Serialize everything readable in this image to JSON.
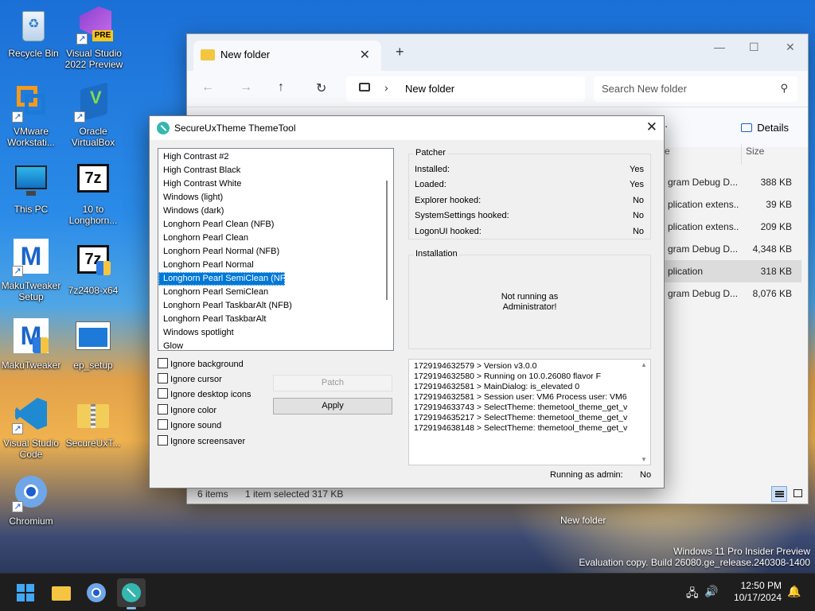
{
  "desktop": {
    "icons": [
      {
        "label": "Recycle Bin",
        "icon": "recycle-bin-icon"
      },
      {
        "label": "Visual Studio 2022 Preview",
        "badge": "PRE",
        "icon": "visual-studio-preview-icon"
      },
      {
        "label": "VMware Workstati...",
        "icon": "vmware-icon"
      },
      {
        "label": "Oracle VirtualBox",
        "icon": "virtualbox-icon"
      },
      {
        "label": "This PC",
        "icon": "monitor-icon"
      },
      {
        "label": "10 to Longhorn...",
        "icon": "7zip-icon"
      },
      {
        "label": "MakuTweaker Setup",
        "icon": "makutweaker-icon"
      },
      {
        "label": "7z2408-x64",
        "icon": "7zip-installer-icon"
      },
      {
        "label": "MakuTweaker",
        "icon": "makutweaker-icon"
      },
      {
        "label": "ep_setup",
        "icon": "setup-icon"
      },
      {
        "label": "Visual Studio Code",
        "icon": "vscode-icon"
      },
      {
        "label": "SecureUxT...",
        "icon": "zip-folder-icon"
      },
      {
        "label": "Chromium",
        "icon": "chromium-icon"
      },
      {
        "label": "New folder"
      }
    ],
    "watermark_line1": "Windows 11 Pro Insider Preview",
    "watermark_line2": "Evaluation copy. Build 26080.ge_release.240308-1400"
  },
  "explorer": {
    "tab_title": "New folder",
    "address": "New folder",
    "search_placeholder": "Search New folder",
    "details_label": "Details",
    "col_name_partial": "e",
    "col_size": "Size",
    "files": [
      {
        "name": "gram Debug D...",
        "size": "388 KB",
        "selected": false
      },
      {
        "name": "plication extens...",
        "size": "39 KB",
        "selected": false
      },
      {
        "name": "plication extens...",
        "size": "209 KB",
        "selected": false
      },
      {
        "name": "gram Debug D...",
        "size": "4,348 KB",
        "selected": false
      },
      {
        "name": "plication",
        "size": "318 KB",
        "selected": true
      },
      {
        "name": "gram Debug D...",
        "size": "8,076 KB",
        "selected": false
      }
    ],
    "status_items": "6 items",
    "status_selected": "1 item selected  317 KB"
  },
  "dialog": {
    "title": "SecureUxTheme ThemeTool",
    "themes": [
      "High Contrast #2",
      "High Contrast Black",
      "High Contrast White",
      "Windows (light)",
      "Windows (dark)",
      "Longhorn Pearl Clean (NFB)",
      "Longhorn Pearl Clean",
      "Longhorn Pearl Normal (NFB)",
      "Longhorn Pearl Normal",
      "Longhorn Pearl SemiClean (NFB)",
      "Longhorn Pearl SemiClean",
      "Longhorn Pearl TaskbarAlt (NFB)",
      "Longhorn Pearl TaskbarAlt",
      "Windows spotlight",
      "Glow"
    ],
    "selected_theme_index": 9,
    "options": [
      "Ignore background",
      "Ignore cursor",
      "Ignore desktop icons",
      "Ignore color",
      "Ignore sound",
      "Ignore screensaver"
    ],
    "patch_label": "Patch",
    "apply_label": "Apply",
    "patcher": {
      "legend": "Patcher",
      "rows": [
        {
          "k": "Installed:",
          "v": "Yes"
        },
        {
          "k": "Loaded:",
          "v": "Yes"
        },
        {
          "k": "Explorer hooked:",
          "v": "No"
        },
        {
          "k": "SystemSettings hooked:",
          "v": "No"
        },
        {
          "k": "LogonUI hooked:",
          "v": "No"
        }
      ]
    },
    "installation": {
      "legend": "Installation",
      "message_line1": "Not running as",
      "message_line2": "Administrator!"
    },
    "log": [
      "1729194632579 > Version v3.0.0",
      "1729194632580 > Running on 10.0.26080 flavor F",
      "1729194632581 > MainDialog: is_elevated 0",
      "1729194632581 > Session user: VM6 Process user: VM6",
      "1729194633743 > SelectTheme: themetool_theme_get_v",
      "1729194635217 > SelectTheme: themetool_theme_get_v",
      "1729194638148 > SelectTheme: themetool_theme_get_v"
    ],
    "admin_label": "Running as admin:",
    "admin_value": "No"
  },
  "taskbar": {
    "time": "12:50 PM",
    "date": "10/17/2024"
  }
}
